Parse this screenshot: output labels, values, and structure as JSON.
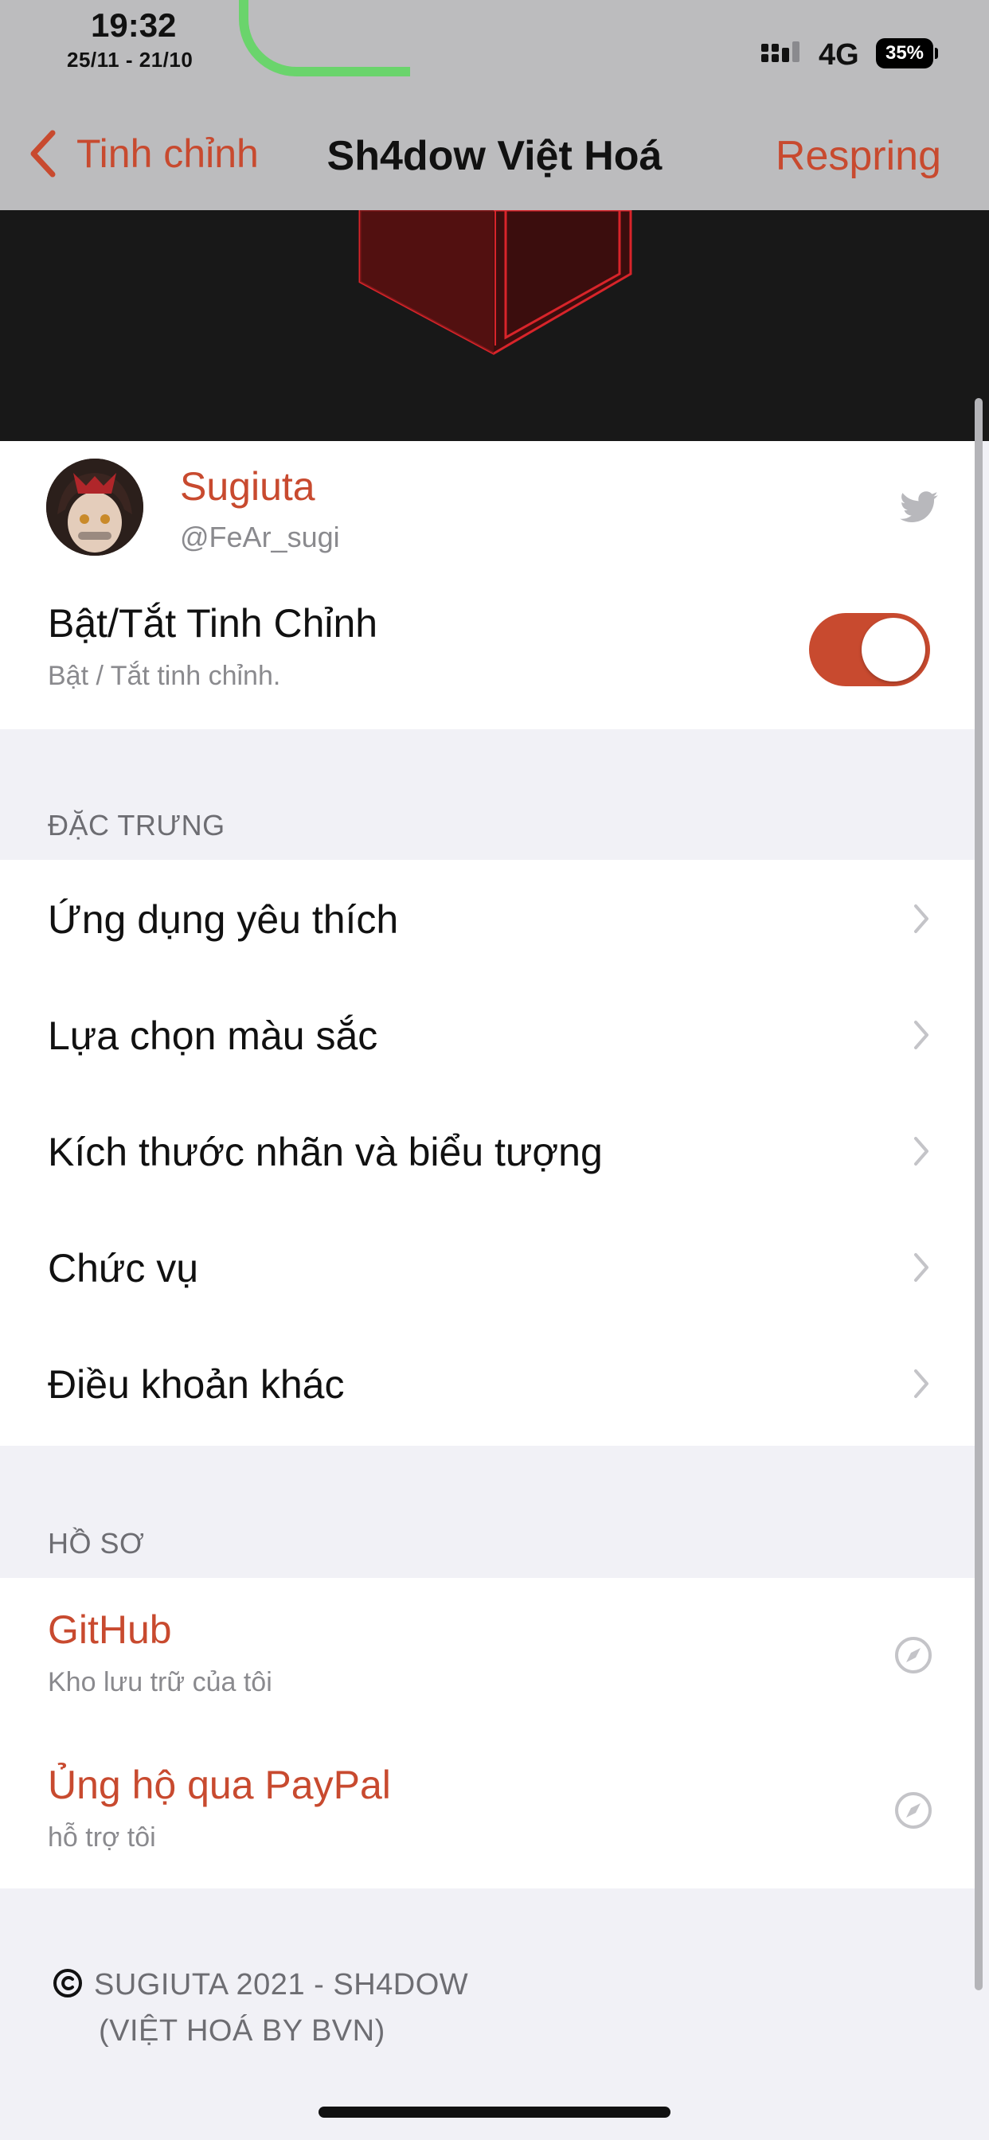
{
  "status_bar": {
    "time": "19:32",
    "date": "25/11 - 21/10",
    "network": "4G",
    "battery": "35%"
  },
  "nav": {
    "back_label": "Tinh chỉnh",
    "title": "Sh4dow Việt Hoá",
    "right_button": "Respring"
  },
  "profile": {
    "name": "Sugiuta",
    "handle": "@FeAr_sugi"
  },
  "toggle": {
    "title": "Bật/Tắt Tinh Chỉnh",
    "subtitle": "Bật / Tắt tinh chỉnh.",
    "state": "on"
  },
  "features": {
    "header": "ĐẶC TRƯNG",
    "items": [
      "Ứng dụng yêu thích",
      "Lựa chọn màu sắc",
      "Kích thước nhãn và biểu tượng",
      "Chức vụ",
      "Điều khoản khác"
    ]
  },
  "profile_links": {
    "header": "HỒ SƠ",
    "items": [
      {
        "title": "GitHub",
        "subtitle": "Kho lưu trữ của tôi"
      },
      {
        "title": "Ủng hộ qua PayPal",
        "subtitle": "hỗ trợ tôi"
      }
    ]
  },
  "footer": {
    "line1": "SUGIUTA 2021 - SH4DOW",
    "line2": "(VIỆT HOÁ BY BVN)"
  },
  "colors": {
    "accent": "#c84a2f",
    "status_bar_bg": "#bcbcbe",
    "grouped_bg": "#f1f1f6",
    "banner_bg": "#181818"
  }
}
